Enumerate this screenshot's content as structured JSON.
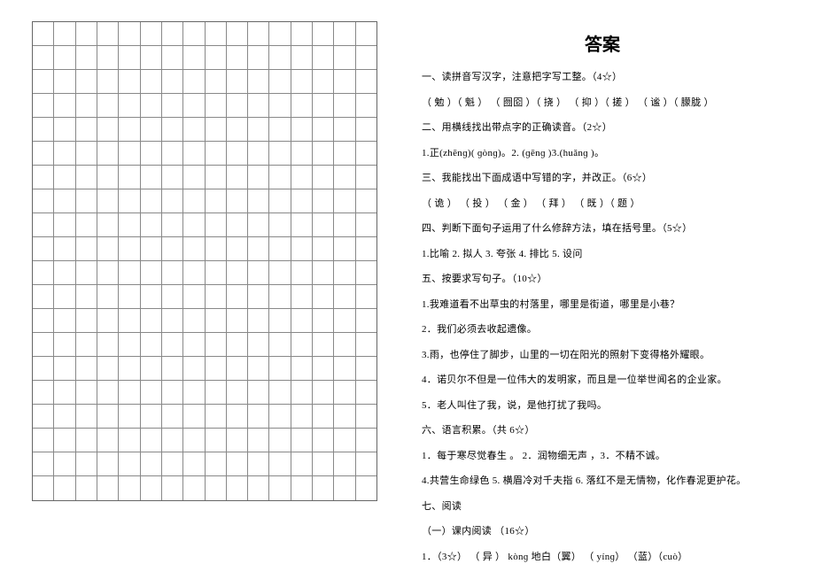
{
  "grid": {
    "rows": 20,
    "cols": 16
  },
  "title": "答案",
  "lines": [
    "一、读拼音写汉字，注意把字写工整。（4☆）",
    "（ 勉 ）（ 魁 ） （ 囫囵 ）（ 挠 ）      （ 抑 ）（ 搓 ）    （ 谧 ）（ 朦胧 ）",
    "二、用横线找出带点字的正确读音。（2☆）",
    "1.正(zhēnɡ)( ɡònɡ)。2. (ɡēnɡ )3.(huǎnɡ )。",
    "三、我能找出下面成语中写错的字，并改正。（6☆）",
    "（ 诡 ）     （ 投 ）     （ 金 ）  （ 拜 ） （ 既  ）（ 题 ）",
    "四、判断下面句子运用了什么修辞方法，填在括号里。（5☆）",
    "1.比喻  2.  拟人  3.  夸张  4. 排比 5. 设问",
    "五、按要求写句子。（10☆）",
    "1.我难道看不出草虫的村落里，哪里是街道，哪里是小巷？",
    "2．我们必须去收起遗像。",
    "3.雨，也停住了脚步，山里的一切在阳光的照射下变得格外耀眼。",
    "4．诺贝尔不但是一位伟大的发明家，而且是一位举世闻名的企业家。",
    "5．老人叫住了我，说，是他打扰了我吗。",
    "六、语言积累。（共 6☆）",
    "  1．每于寒尽觉春生 。  2．润物细无声 ，3．不精不诚。",
    " 4.共营生命绿色  5. 横眉冷对千夫指  6. 落红不是无情物，化作春泥更护花。",
    "七、阅读",
    "（一）课内阅读 （16☆）",
    "1．（3☆） （ 异 ）        kònɡ   地白（翼）     （  yínɡ）    （蓝）（cuò）"
  ]
}
